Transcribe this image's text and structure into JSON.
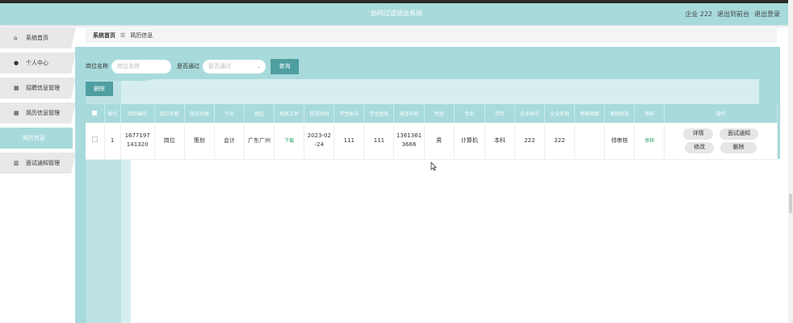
{
  "header": {
    "title": "协同过滤就业系统",
    "user_label": "企业 222",
    "to_frontend": "退出到前台",
    "logout": "退出登录"
  },
  "sidebar": {
    "items": [
      {
        "label": "系统首页",
        "icon": "home-icon"
      },
      {
        "label": "个人中心",
        "icon": "user-icon"
      },
      {
        "label": "招聘信息管理",
        "icon": "grid-icon"
      },
      {
        "label": "简历信息管理",
        "icon": "grid-icon"
      },
      {
        "label": "简历信息",
        "icon": "",
        "active": true
      },
      {
        "label": "面试通知管理",
        "icon": "bar-chart-icon"
      }
    ]
  },
  "breadcrumb": {
    "home": "系统首页",
    "separator": "☰",
    "current": "简历信息"
  },
  "search": {
    "position_label": "岗位名称",
    "position_placeholder": "岗位名称",
    "passed_label": "是否通过",
    "passed_placeholder": "是否通过",
    "search_button": "查询"
  },
  "actions": {
    "delete_button": "删除"
  },
  "table": {
    "headers": [
      "",
      "索引",
      "简历编号",
      "岗位名称",
      "岗位分类",
      "行业",
      "地区",
      "相关文件",
      "提交时间",
      "学生账号",
      "学生姓名",
      "电话号码",
      "性别",
      "专业",
      "学历",
      "企业账号",
      "企业名称",
      "审核回复",
      "审核状态",
      "审核",
      "操作"
    ],
    "rows": [
      {
        "index": "1",
        "resume_no": "1677197141320",
        "resume_no_l1": "1677197",
        "resume_no_l2": "141320",
        "position": "岗位",
        "category": "策划",
        "industry": "会计",
        "region": "广东广州",
        "file": "下载",
        "submit_time_l1": "2023-02",
        "submit_time_l2": "-24",
        "student_account": "111",
        "student_name": "111",
        "phone_l1": "1361361",
        "phone_l2": "3666",
        "gender": "男",
        "major": "计算机",
        "education": "本科",
        "company_account": "222",
        "company_name": "222",
        "review_reply": "",
        "review_status": "待审核",
        "review": "审核",
        "ops": {
          "detail": "详情",
          "notify": "面试通知",
          "edit": "修改",
          "delete": "删除"
        }
      }
    ]
  }
}
